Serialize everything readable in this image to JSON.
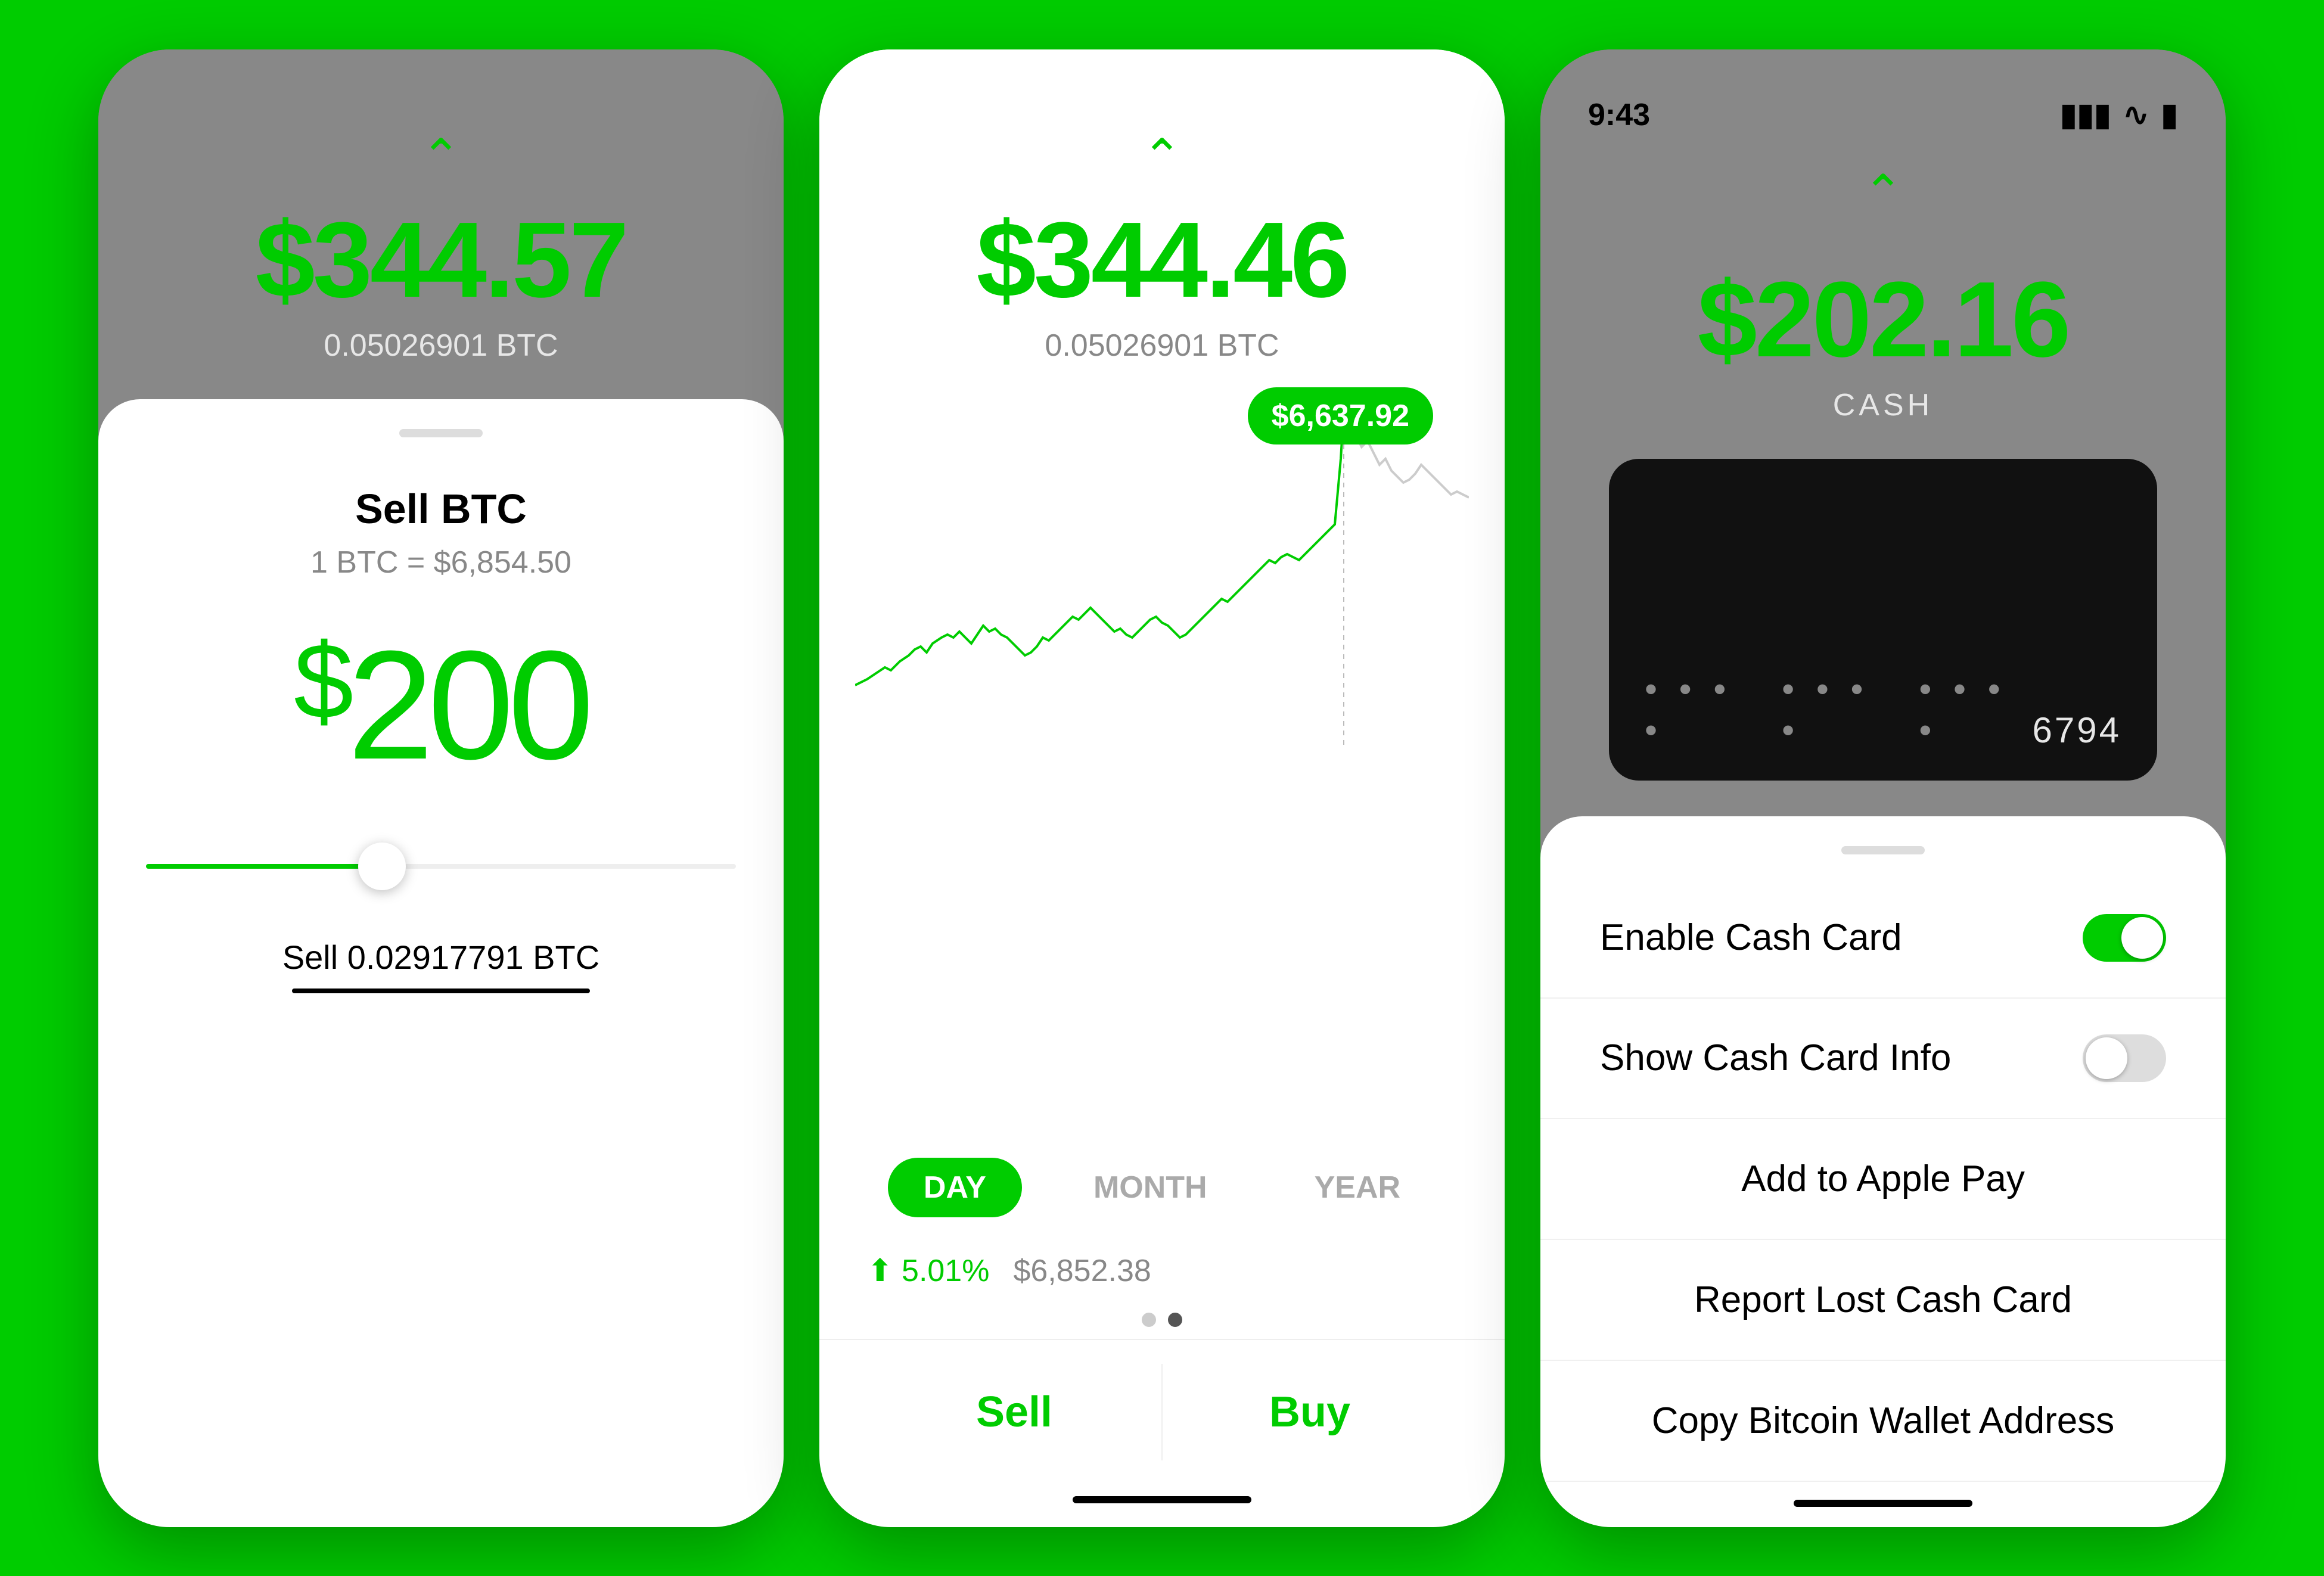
{
  "screen1": {
    "chevron": "^",
    "btcPrice": "$344.57",
    "btcAmount": "0.05026901 BTC",
    "sheetTitle": "Sell BTC",
    "exchangeRate": "1 BTC = $6,854.50",
    "sellAmount": "$200",
    "sellAmountDollar": "$",
    "sellAmountNumber": "200",
    "sellBtcLabel": "Sell 0.02917791 BTC"
  },
  "screen2": {
    "chevron": "^",
    "btcPrice": "$344.46",
    "btcAmount": "0.05026901 BTC",
    "chartTooltip": "$6,637.92",
    "timePeriods": [
      "DAY",
      "MONTH",
      "YEAR"
    ],
    "activePeriod": 0,
    "changePercent": "⬆ 5.01%",
    "changePrice": "$6,852.38",
    "sellLabel": "Sell",
    "buyLabel": "Buy"
  },
  "screen3": {
    "statusTime": "9:43",
    "chevron": "^",
    "cashAmount": "$202.16",
    "cashLabel": "CASH",
    "cardDots1": "• • • •",
    "cardDots2": "• • • •",
    "cardDots3": "• • • •",
    "cardNumber": "6794",
    "enableCashCardLabel": "Enable Cash Card",
    "showCashCardInfoLabel": "Show Cash Card Info",
    "addToApplePayLabel": "Add to Apple Pay",
    "reportLostLabel": "Report Lost Cash Card",
    "copyBitcoinLabel": "Copy Bitcoin Wallet Address"
  }
}
